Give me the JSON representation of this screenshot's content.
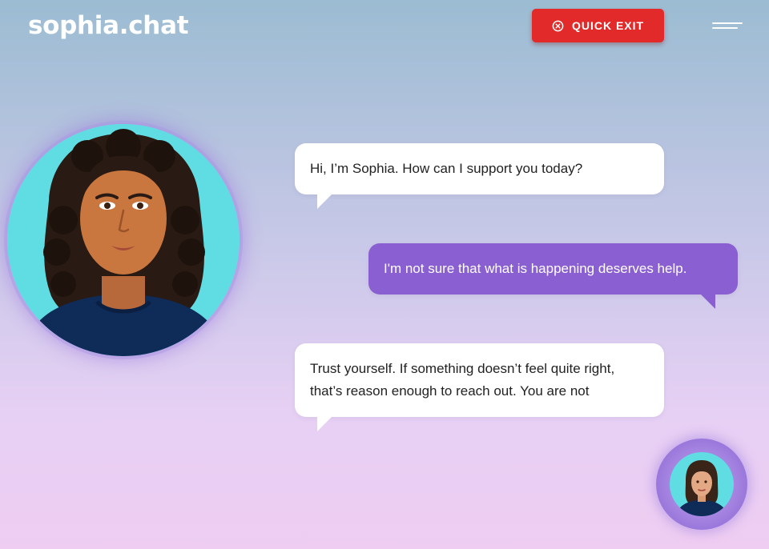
{
  "header": {
    "logo": "sophia.chat",
    "quick_exit_label": "QUICK EXIT",
    "quick_exit_color": "#e22a2a"
  },
  "avatar": {
    "icon": "sophia-avatar-illustration",
    "bg_color": "#5fdde3"
  },
  "messages": [
    {
      "sender": "bot",
      "text": "Hi, I’m Sophia. How can I support you today?"
    },
    {
      "sender": "user",
      "text": "I'm not sure that what is happening deserves help."
    },
    {
      "sender": "bot",
      "line1": "Trust yourself. If something doesn’t feel quite right,",
      "line2": "that’s reason enough to reach out. You are not"
    }
  ],
  "colors": {
    "user_bubble": "#8a5fd1",
    "bot_bubble": "#ffffff"
  }
}
